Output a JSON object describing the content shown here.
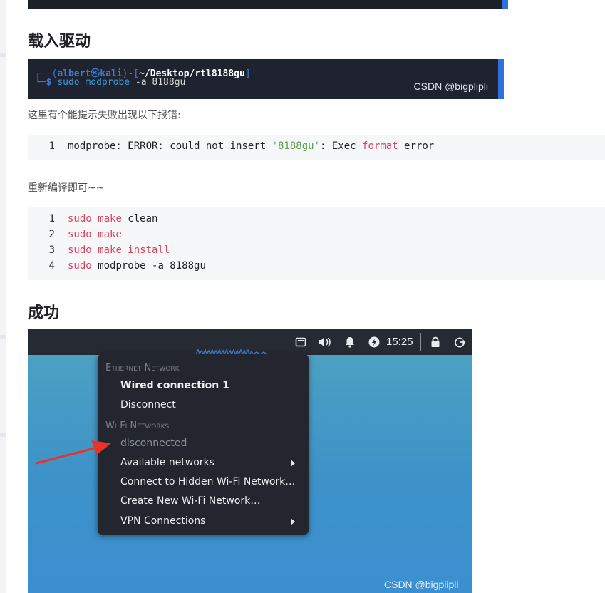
{
  "headings": {
    "load_driver": "载入驱动",
    "success": "成功"
  },
  "terminal": {
    "user": "albert",
    "at_symbol": "㉿",
    "host": "kali",
    "path": "~/Desktop/rtl8188gu",
    "line1_prefix": "┌──(",
    "line1_mid": ")-[",
    "line1_suffix": "]",
    "line2_prefix": "└─$",
    "cmd_sudo": "sudo",
    "cmd_modprobe": "modprobe",
    "cmd_args": "-a 8188gu",
    "watermark": "CSDN @bigplipli"
  },
  "paragraphs": {
    "error_intro": "这里有个能提示失败出现以下报错:",
    "recompile": "重新编译即可~~"
  },
  "error_code": {
    "line_number": "1",
    "part1": "modprobe: ERROR: could not insert ",
    "str": "'8188gu'",
    "part2": ": Exec ",
    "kw": "format",
    "part3": " error"
  },
  "build_code": [
    {
      "n": "1",
      "a": "sudo",
      "b": "make",
      "c": " clean"
    },
    {
      "n": "2",
      "a": "sudo",
      "b": "make",
      "c": ""
    },
    {
      "n": "3",
      "a": "sudo",
      "b": "make",
      "c": " install"
    },
    {
      "n": "4",
      "a": "sudo",
      "b": "",
      "c": "modprobe -a 8188gu"
    }
  ],
  "screenshot": {
    "clock": "15:25",
    "tray_icons": [
      "network-icon",
      "volume-icon",
      "bell-icon",
      "power-icon",
      "lock-icon",
      "logout-icon"
    ],
    "menu": {
      "ethernet_header": "Ethernet Network",
      "wired_connection": "Wired connection 1",
      "disconnect": "Disconnect",
      "wifi_header": "Wi-Fi Networks",
      "disconnected": "disconnected",
      "available_networks": "Available networks",
      "connect_hidden": "Connect to Hidden Wi-Fi Network…",
      "create_new": "Create New Wi-Fi Network…",
      "vpn": "VPN Connections"
    },
    "watermark": "CSDN @bigplipli"
  },
  "colors": {
    "code_keyword": "#d9435e",
    "code_string": "#5aa34a",
    "terminal_bg": "#1f2330",
    "accent_bar": "#2f6fde",
    "arrow": "#e8322a"
  }
}
